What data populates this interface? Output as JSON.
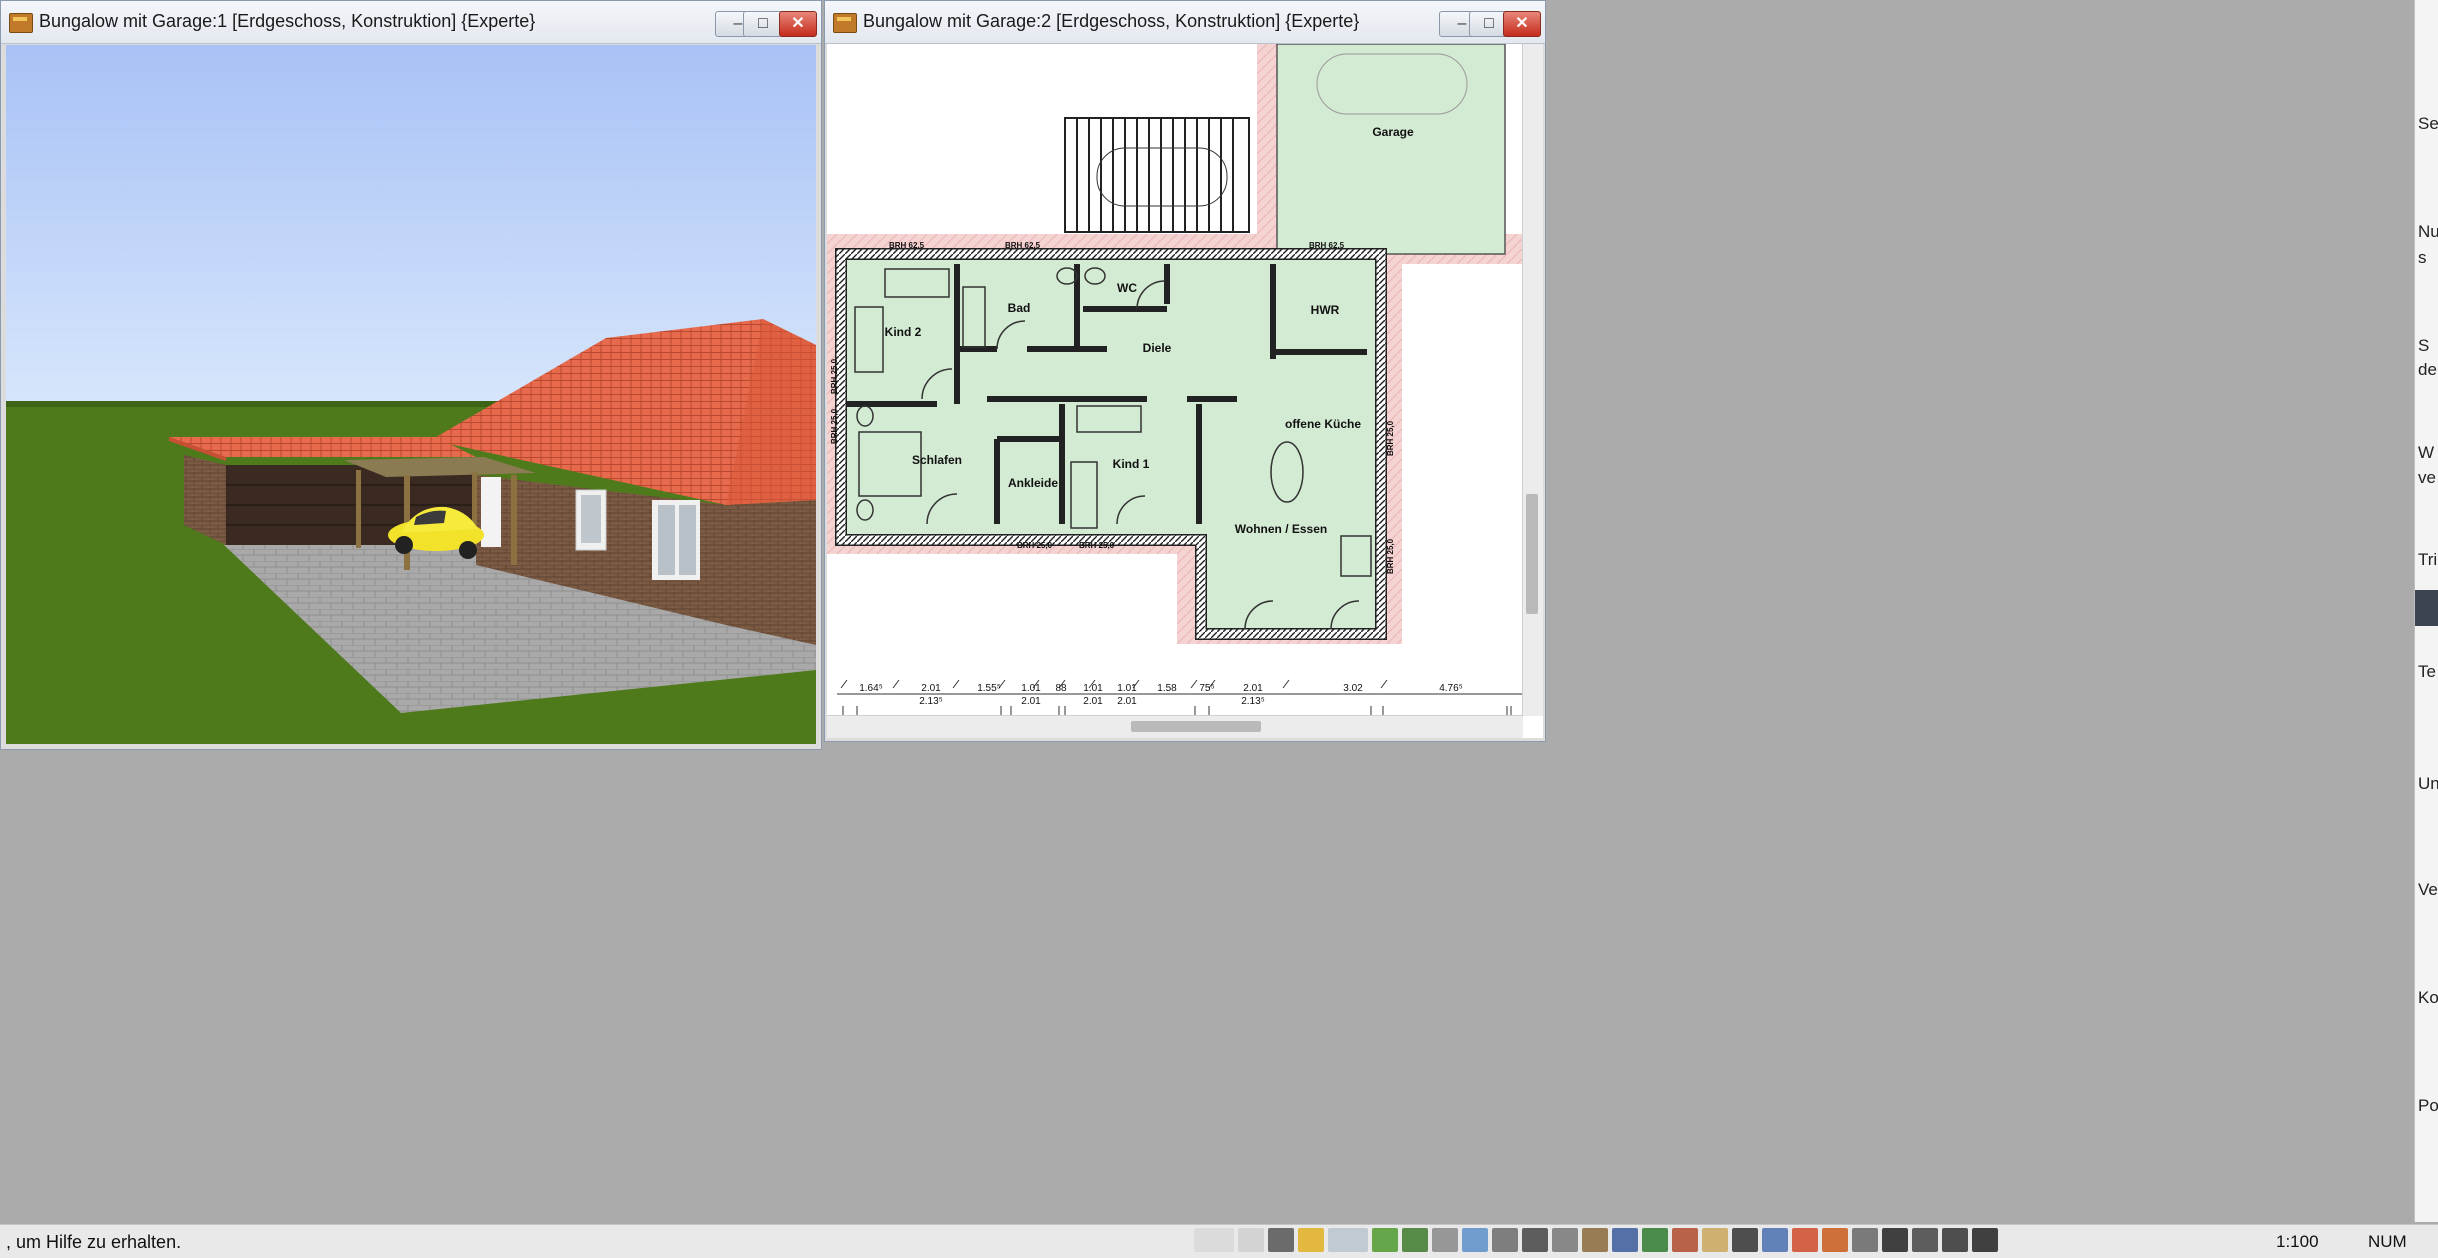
{
  "left_window": {
    "title": "Bungalow mit Garage:1 [Erdgeschoss, Konstruktion] {Experte}",
    "minimize": "–",
    "maximize": "□",
    "close": "✕"
  },
  "right_window": {
    "title": "Bungalow mit Garage:2 [Erdgeschoss, Konstruktion] {Experte}",
    "minimize": "–",
    "maximize": "□",
    "close": "✕"
  },
  "floor_plan": {
    "rooms": [
      "Garage",
      "WC",
      "Bad",
      "Kind 2",
      "HWR",
      "Diele",
      "offene Küche",
      "Schlafen",
      "Ankleide",
      "Kind 1",
      "Wohnen / Essen"
    ],
    "brh_labels": [
      "BRH 62,5",
      "BRH 62,5",
      "BRH 62,5",
      "BRH 25,0",
      "BRH 25,0",
      "BRH 25,0",
      "BRH 25,0",
      "BRH 25,0",
      "BRH 25,0"
    ],
    "dimensions_top": [
      "1.64⁵",
      "2.01",
      "1.55⁵",
      "1.01",
      "88",
      "1.01",
      "1.01",
      "1.58",
      "75⁵",
      "2.01",
      "3.02",
      "4.76⁵"
    ],
    "dimensions_bottom": [
      "2.13⁵",
      "2.01",
      "2.01",
      "2.01",
      "2.13⁵"
    ]
  },
  "right_panel": {
    "labels": [
      "Se",
      "Nu",
      "s",
      "S",
      "de",
      "W",
      "ve",
      "Tri",
      "Te",
      "Un",
      "Ve",
      "Ko",
      "Po"
    ]
  },
  "statusbar": {
    "message": ", um Hilfe zu erhalten.",
    "scale": "1:100",
    "num": "NUM"
  },
  "toolbar_icons": [
    "catalog-icon",
    "wall-icon",
    "grid-icon",
    "pencil-icon",
    "slab-icon",
    "terrain-icon",
    "texture-icon",
    "hatch-icon",
    "stairs-icon",
    "symbol-icon",
    "footsteps-icon",
    "roof-icon",
    "furniture-icon",
    "chair-icon",
    "tree-icon",
    "dormer-icon",
    "trim-icon",
    "light-icon",
    "window-icon",
    "color-icon",
    "3d-icon",
    "dimension-icon",
    "text-abc-icon",
    "5m-icon",
    "north-arrow-icon",
    "camera-icon"
  ],
  "colors": {
    "sky_top": "#a8c7f8",
    "grass": "#4f7a1c",
    "roof": "#e8664a",
    "room_fill": "#d3ead3",
    "pink_hatch": "#f3c9c9"
  }
}
